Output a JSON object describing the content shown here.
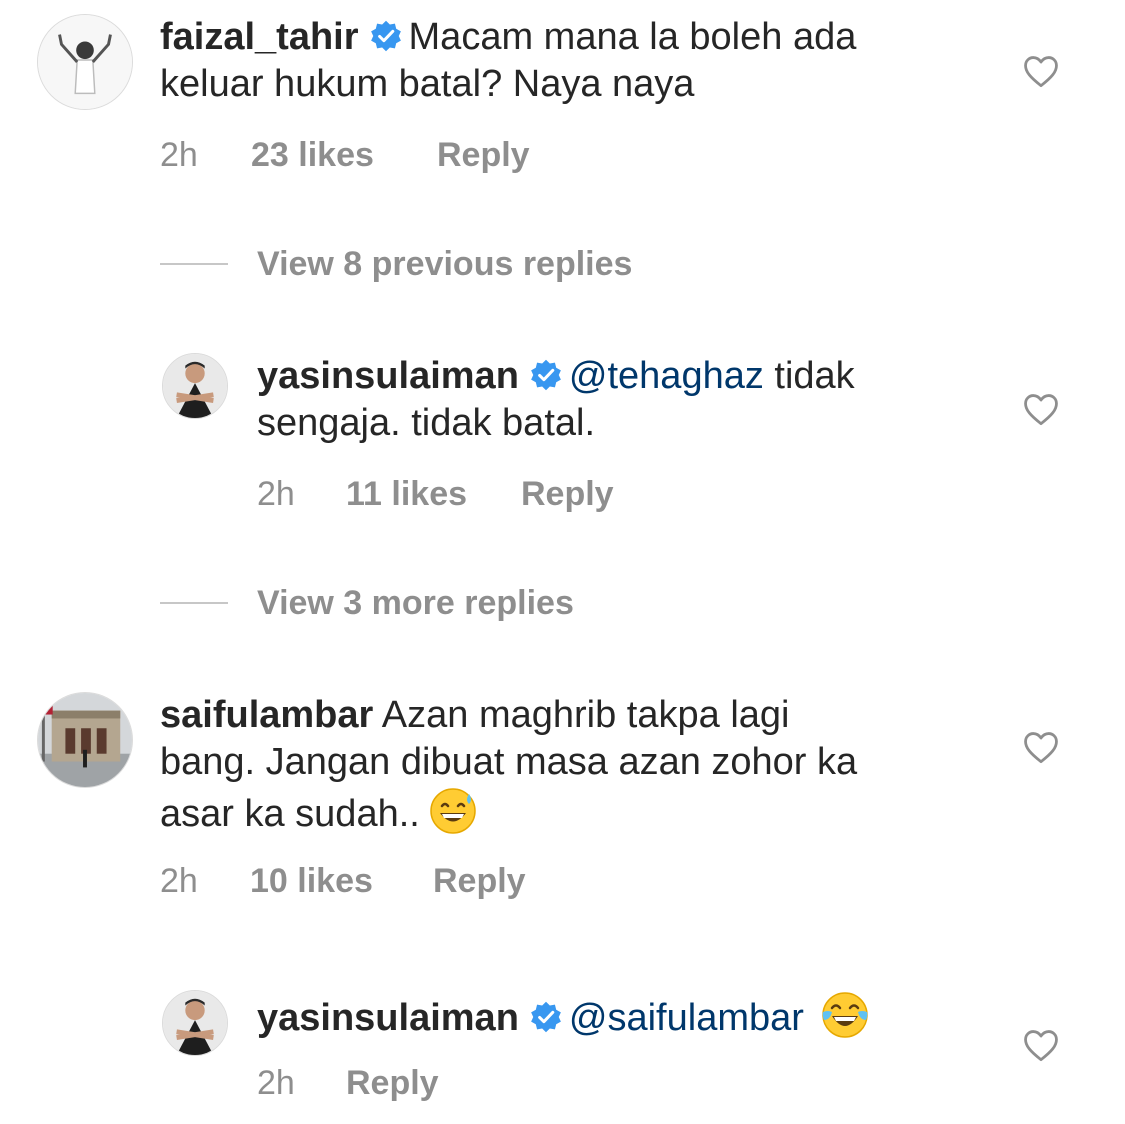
{
  "comments": [
    {
      "username": "faizal_tahir",
      "verified": true,
      "text_line1": "Macam mana la boleh ada",
      "text_line2": "keluar hukum batal? Naya naya",
      "time": "2h",
      "likes": "23 likes",
      "reply": "Reply",
      "avatar_icon": "person-arms-raised-avatar"
    },
    {
      "username": "yasinsulaiman",
      "verified": true,
      "mention": "@tehaghaz",
      "text_line1": " tidak",
      "text_line2": "sengaja. tidak batal.",
      "time": "2h",
      "likes": "11 likes",
      "reply": "Reply",
      "avatar_icon": "man-crossed-arms-avatar"
    },
    {
      "username": "saifulambar",
      "verified": false,
      "text_line1": "Azan maghrib takpa lagi",
      "text_line2": "bang. Jangan dibuat masa azan zohor ka",
      "text_line3": "asar ka sudah..",
      "emoji": "grinning-face-with-sweat-emoji",
      "time": "2h",
      "likes": "10 likes",
      "reply": "Reply",
      "avatar_icon": "building-photo-avatar"
    },
    {
      "username": "yasinsulaiman",
      "verified": true,
      "mention": "@saifulambar",
      "emoji": "face-with-tears-of-joy-emoji",
      "time": "2h",
      "reply": "Reply",
      "avatar_icon": "man-crossed-arms-avatar"
    }
  ],
  "view_previous_replies": "View 8 previous replies",
  "view_more_replies": "View 3 more replies",
  "colors": {
    "text": "#262626",
    "meta": "#8e8e8e",
    "mention": "#00376b",
    "verified": "#3897f0"
  }
}
